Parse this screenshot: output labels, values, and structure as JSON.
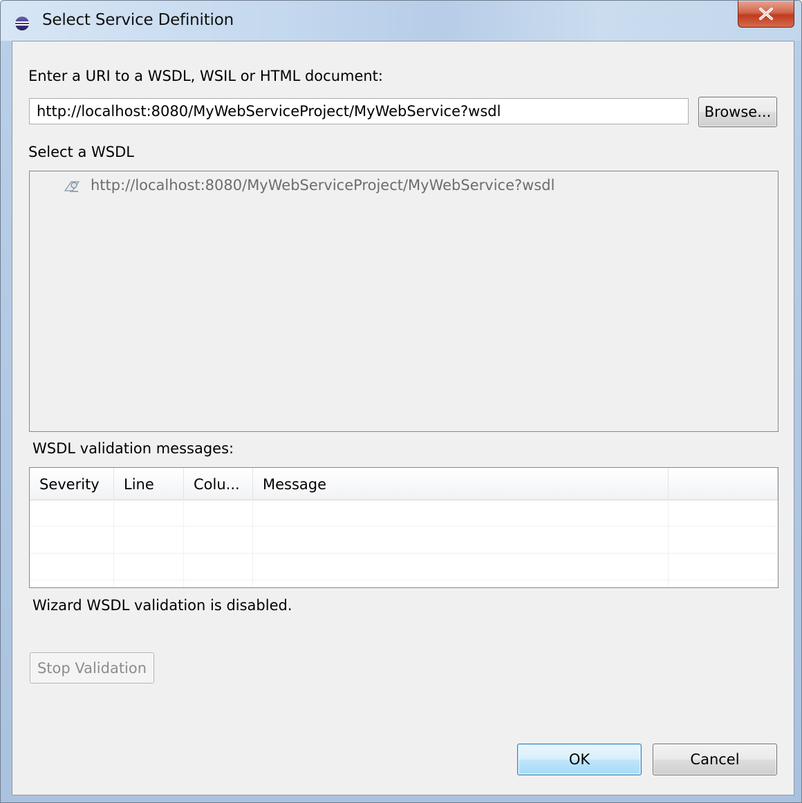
{
  "window": {
    "title": "Select Service Definition",
    "close_label": "X"
  },
  "uri": {
    "label": "Enter a URI to a WSDL, WSIL or HTML document:",
    "value": "http://localhost:8080/MyWebServiceProject/MyWebService?wsdl",
    "browse_label": "Browse..."
  },
  "wsdl_tree": {
    "label": "Select a WSDL",
    "items": [
      {
        "label": "http://localhost:8080/MyWebServiceProject/MyWebService?wsdl",
        "icon": "wsdl-document-icon"
      }
    ]
  },
  "validation": {
    "label": "WSDL validation messages:",
    "columns": [
      "Severity",
      "Line",
      "Colu...",
      "Message",
      ""
    ],
    "rows": [],
    "status": "Wizard WSDL validation is disabled.",
    "stop_label": "Stop Validation"
  },
  "footer": {
    "ok_label": "OK",
    "cancel_label": "Cancel"
  }
}
